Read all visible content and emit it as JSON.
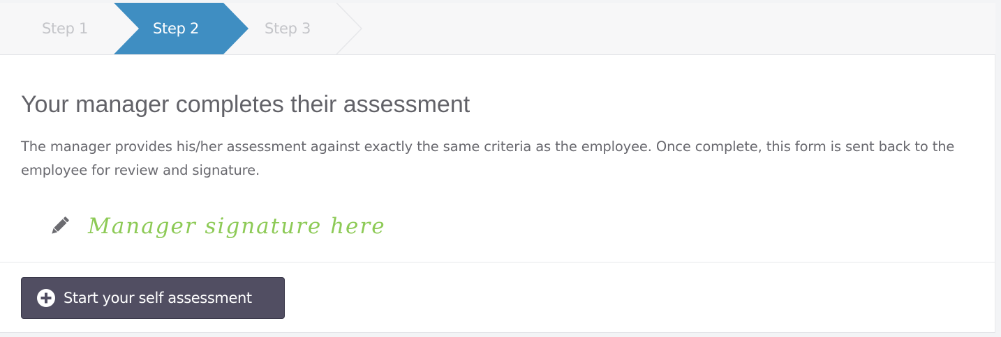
{
  "steps": {
    "items": [
      {
        "label": "Step 1",
        "state": "inactive"
      },
      {
        "label": "Step 2",
        "state": "active"
      },
      {
        "label": "Step 3",
        "state": "inactive"
      }
    ],
    "active_color": "#3f8ec2",
    "inactive_color": "#c4c5c9"
  },
  "content": {
    "title": "Your manager completes their assessment",
    "description": "The manager provides his/her assessment against exactly the same criteria as the employee. Once complete, this form is sent back to the employee for review and signature.",
    "signature": {
      "icon": "pencil-icon",
      "text": "Manager signature here",
      "color": "#8dca56"
    }
  },
  "action": {
    "icon": "plus-circle-icon",
    "label": "Start your self assessment",
    "color": "#514e62"
  }
}
